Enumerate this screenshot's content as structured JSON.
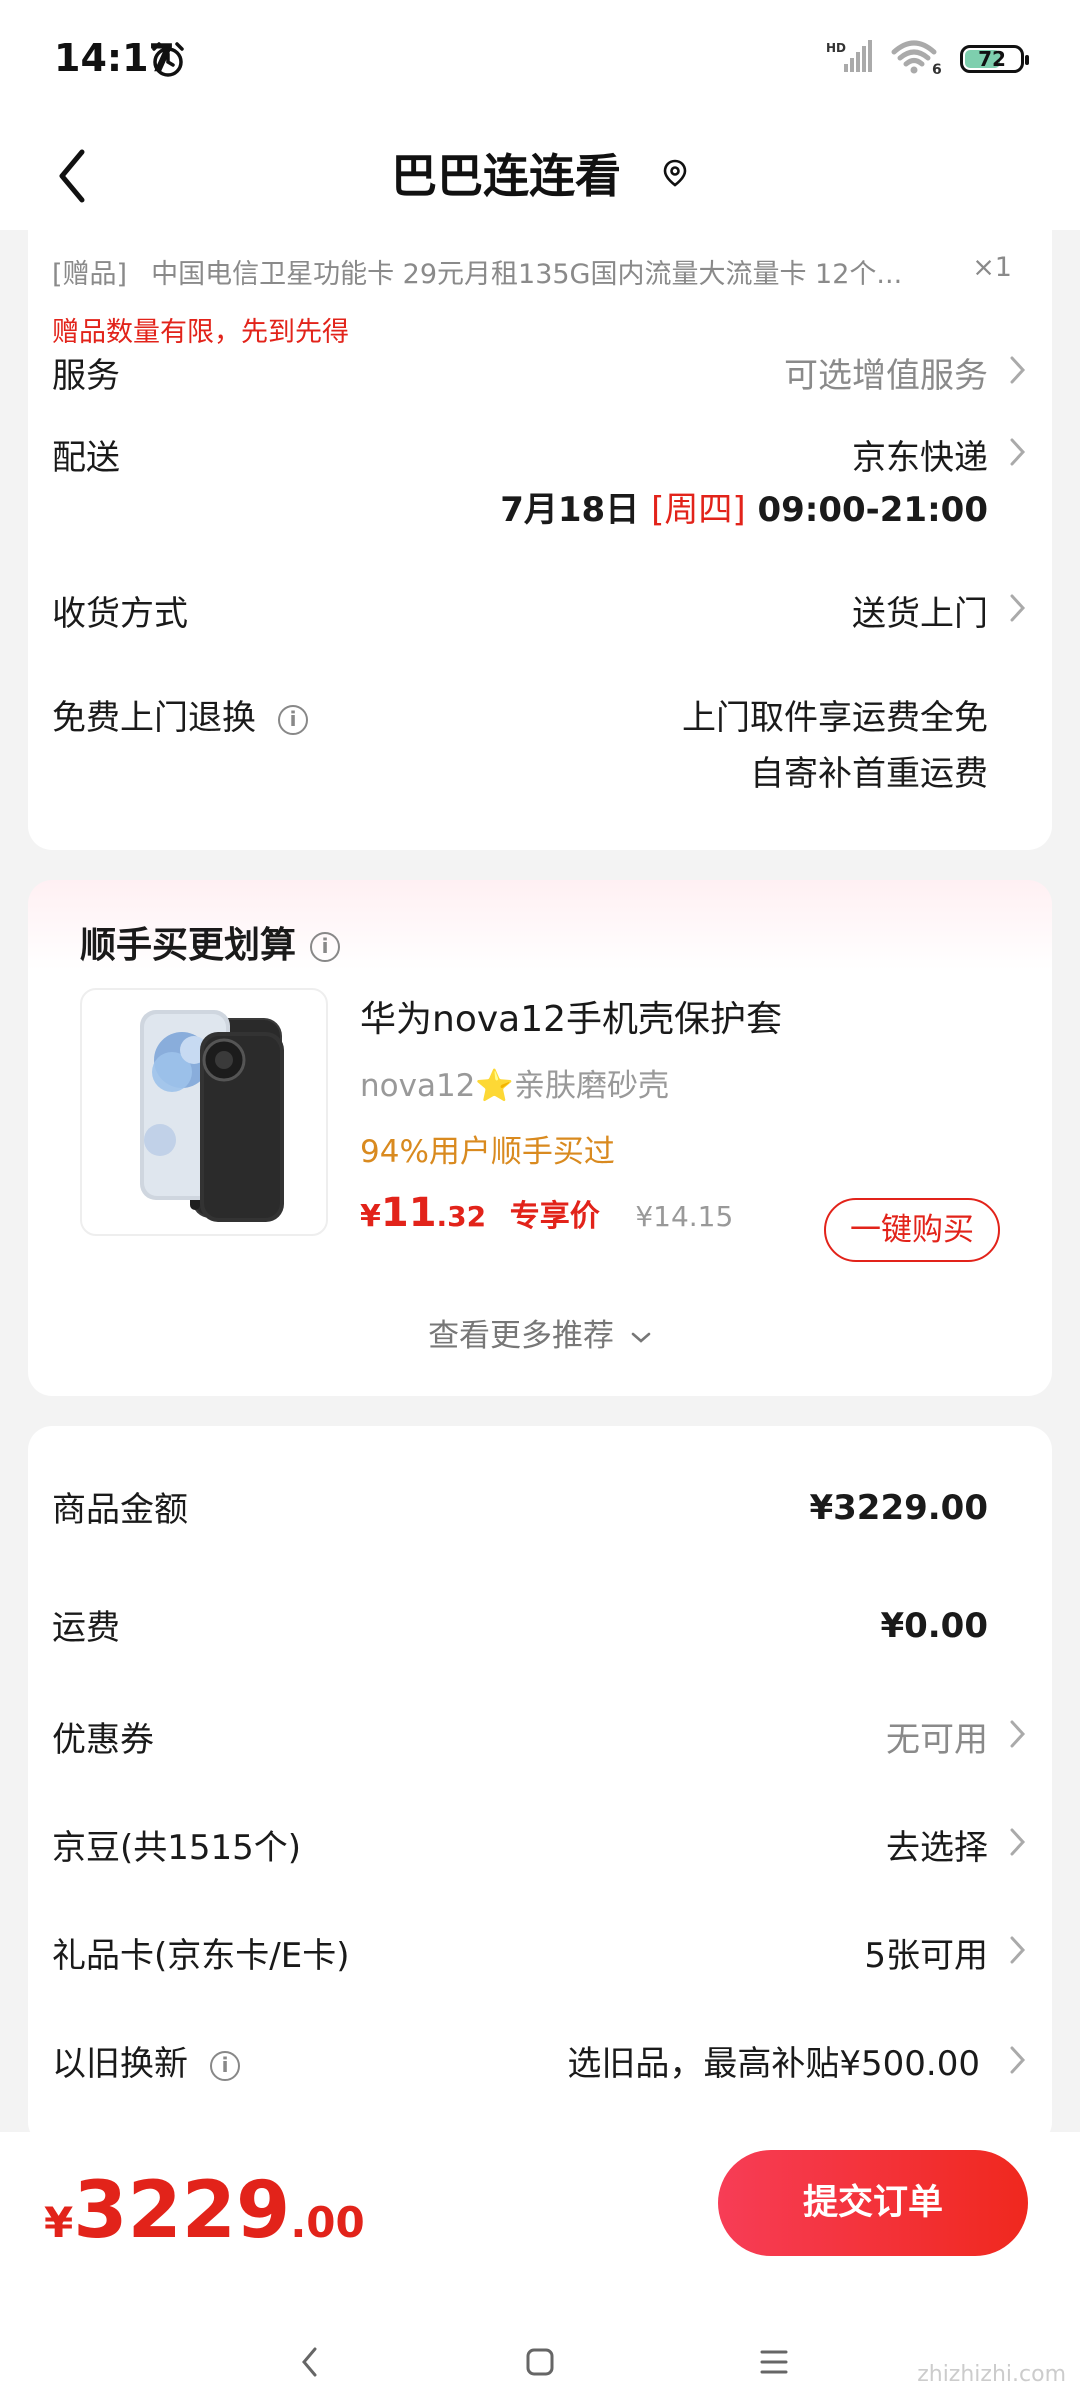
{
  "status_bar": {
    "time": "14:17",
    "network": "HD",
    "wifi_gen": "6",
    "battery": "72"
  },
  "nav": {
    "title": "巴巴连连看"
  },
  "gift": {
    "tag": "[赠品]",
    "text": "中国电信卫星功能卡 29元月租135G国内流量大流量卡 12个...",
    "qty": "×1",
    "warning": "赠品数量有限，先到先得"
  },
  "service": {
    "label": "服务",
    "value": "可选增值服务"
  },
  "delivery": {
    "label": "配送",
    "value": "京东快递",
    "date": "7月18日",
    "weekday": "[周四]",
    "time_range": "09:00-21:00"
  },
  "receive": {
    "label": "收货方式",
    "value": "送货上门"
  },
  "free_return": {
    "label": "免费上门退换",
    "line1": "上门取件享运费全免",
    "line2": "自寄补首重运费"
  },
  "recommend": {
    "title": "顺手买更划算",
    "product_name": "华为nova12手机壳保护套",
    "product_sub": "nova12⭐亲肤磨砂壳",
    "tip": "94%用户顺手买过",
    "price_currency": "¥",
    "price_int": "11",
    "price_dec": ".32",
    "price_tag": "专享价",
    "orig_price": "¥14.15",
    "buy_label": "一键购买",
    "more_label": "查看更多推荐"
  },
  "summary": {
    "goods_label": "商品金额",
    "goods_value": "¥3229.00",
    "freight_label": "运费",
    "freight_value": "¥0.00",
    "coupon_label": "优惠券",
    "coupon_value": "无可用",
    "jingdou_label": "京豆(共1515个)",
    "jingdou_value": "去选择",
    "giftcard_label": "礼品卡(京东卡/E卡)",
    "giftcard_value": "5张可用",
    "tradein_label": "以旧换新",
    "tradein_value": "选旧品，最高补贴¥500.00"
  },
  "bottom": {
    "currency": "¥",
    "total_int": "3229",
    "total_dec": ".00",
    "submit_label": "提交订单",
    "watermark": "zhizhizhi.com"
  },
  "colors": {
    "accent": "#e2231a",
    "tip": "#d98a1f"
  }
}
